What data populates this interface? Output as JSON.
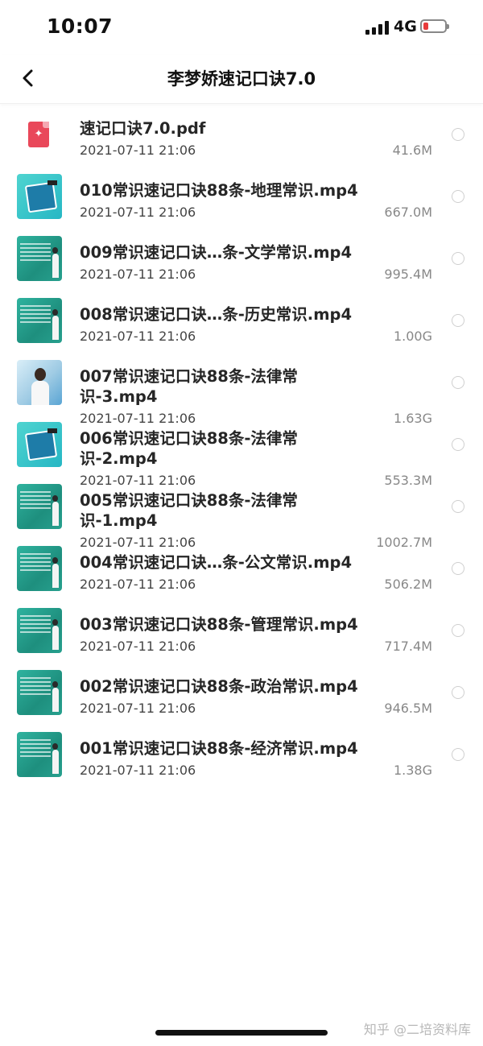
{
  "status": {
    "time": "10:07",
    "network": "4G"
  },
  "header": {
    "title": "李梦娇速记口诀7.0"
  },
  "files": [
    {
      "name": "速记口诀7.0.pdf",
      "date": "2021-07-11 21:06",
      "size": "41.6M",
      "thumb": "pdf"
    },
    {
      "name": "010常识速记口诀88条-地理常识.mp4",
      "date": "2021-07-11 21:06",
      "size": "667.0M",
      "thumb": "cover"
    },
    {
      "name": "009常识速记口诀…条-文学常识.mp4",
      "date": "2021-07-11 21:06",
      "size": "995.4M",
      "thumb": "video"
    },
    {
      "name": "008常识速记口诀…条-历史常识.mp4",
      "date": "2021-07-11 21:06",
      "size": "1.00G",
      "thumb": "video"
    },
    {
      "name": "007常识速记口诀88条-法律常识-3.mp4",
      "date": "2021-07-11 21:06",
      "size": "1.63G",
      "thumb": "portrait"
    },
    {
      "name": "006常识速记口诀88条-法律常识-2.mp4",
      "date": "2021-07-11 21:06",
      "size": "553.3M",
      "thumb": "cover"
    },
    {
      "name": "005常识速记口诀88条-法律常识-1.mp4",
      "date": "2021-07-11 21:06",
      "size": "1002.7M",
      "thumb": "video"
    },
    {
      "name": "004常识速记口诀…条-公文常识.mp4",
      "date": "2021-07-11 21:06",
      "size": "506.2M",
      "thumb": "video"
    },
    {
      "name": "003常识速记口诀88条-管理常识.mp4",
      "date": "2021-07-11 21:06",
      "size": "717.4M",
      "thumb": "video"
    },
    {
      "name": "002常识速记口诀88条-政治常识.mp4",
      "date": "2021-07-11 21:06",
      "size": "946.5M",
      "thumb": "video"
    },
    {
      "name": "001常识速记口诀88条-经济常识.mp4",
      "date": "2021-07-11 21:06",
      "size": "1.38G",
      "thumb": "video"
    }
  ],
  "watermark": "知乎 @二培资料库",
  "icons": {
    "back": "chevron-left-icon",
    "pdf": "pdf-file-icon",
    "select": "radio-circle-icon"
  },
  "colors": {
    "pdf_red": "#e9485a",
    "battery_low": "#e83b3b",
    "video_teal": "#2fb39f"
  }
}
